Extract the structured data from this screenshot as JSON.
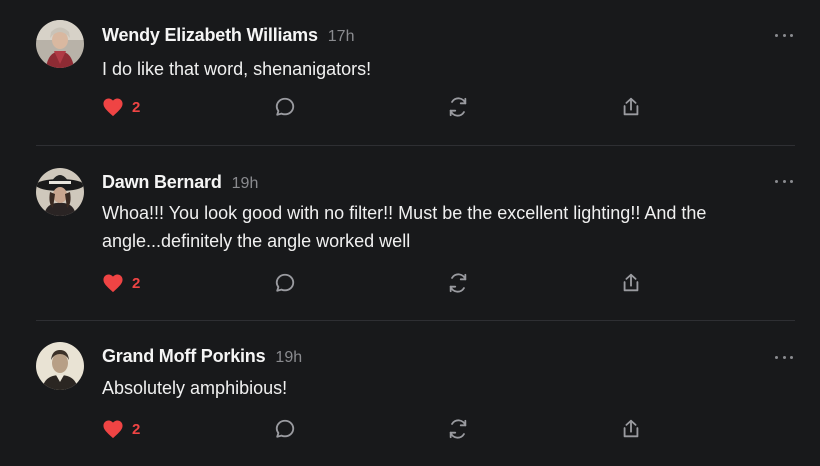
{
  "replies": [
    {
      "author": "Wendy Elizabeth Williams",
      "time": "17h",
      "text": "I do like that word, shenanigators!",
      "likes": "2",
      "avatar": "avatar-photo-woman-red-scarf"
    },
    {
      "author": "Dawn Bernard",
      "time": "19h",
      "text": "Whoa!!! You look good with no filter!! Must be the excellent lighting!! And the angle...definitely the angle worked well",
      "likes": "2",
      "avatar": "avatar-photo-wide-brim-hat"
    },
    {
      "author": "Grand Moff Porkins",
      "time": "19h",
      "text": "Absolutely amphibious!",
      "likes": "2",
      "avatar": "avatar-photo-sepia-portrait"
    }
  ],
  "icons": {
    "like": "heart-icon",
    "comment": "comment-bubble-icon",
    "restack": "restack-icon",
    "share": "share-icon",
    "more": "more-options-icon"
  },
  "colors": {
    "background": "#18191b",
    "like": "#ef4444",
    "muted": "#8a8b8f",
    "divider": "#2e2f33"
  }
}
